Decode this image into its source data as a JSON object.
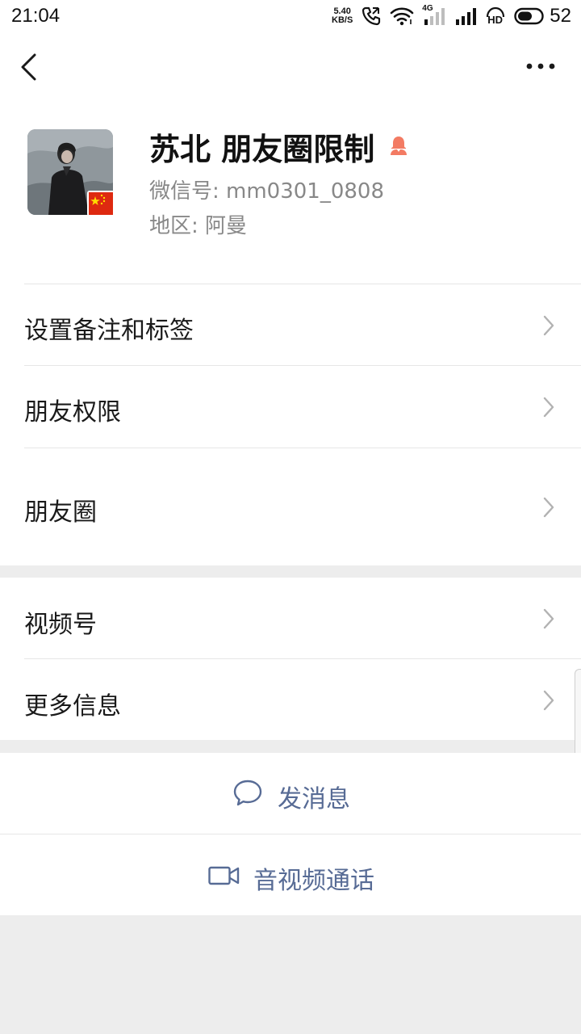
{
  "status_bar": {
    "time": "21:04",
    "net_speed_value": "5.40",
    "net_speed_unit": "KB/S",
    "network_type": "4G",
    "hd_label": "HD",
    "battery_level": "52"
  },
  "nav": {
    "back_icon": "chevron-left-icon",
    "more_icon": "more-dots-icon"
  },
  "profile": {
    "name": "苏北 朋友圈限制",
    "wechat_id": "微信号: mm0301_0808",
    "region": "地区: 阿曼",
    "gender_icon": "female-icon",
    "gender_color": "#f37b63",
    "flag_icon": "china-flag-icon"
  },
  "menu_group1": [
    {
      "label": "设置备注和标签"
    },
    {
      "label": "朋友权限"
    },
    {
      "label": "朋友圈"
    }
  ],
  "menu_group2": [
    {
      "label": "视频号"
    },
    {
      "label": "更多信息"
    }
  ],
  "actions": {
    "message_label": "发消息",
    "call_label": "音视频通话",
    "accent_color": "#576b95"
  }
}
